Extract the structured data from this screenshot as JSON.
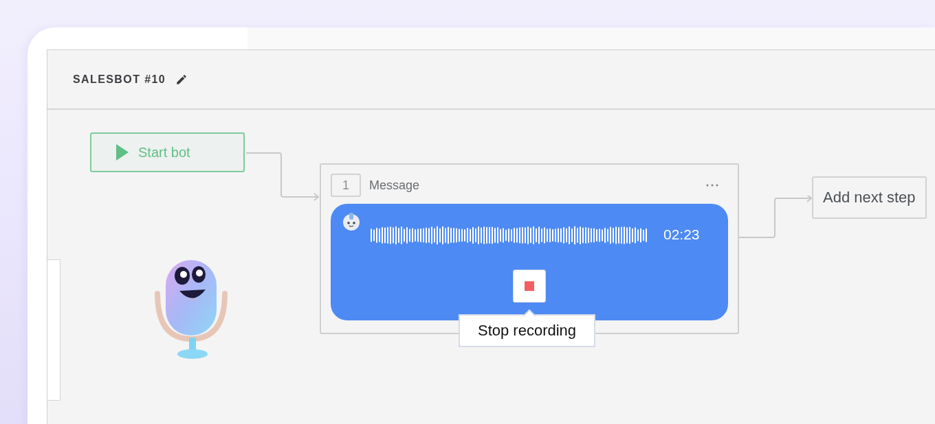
{
  "header": {
    "title": "SALESBOT #10"
  },
  "start_node": {
    "label": "Start bot"
  },
  "message_node": {
    "step_number": "1",
    "title": "Message",
    "voice": {
      "duration": "02:23"
    },
    "stop_tooltip": "Stop recording"
  },
  "next_step": {
    "label": "Add next step"
  }
}
